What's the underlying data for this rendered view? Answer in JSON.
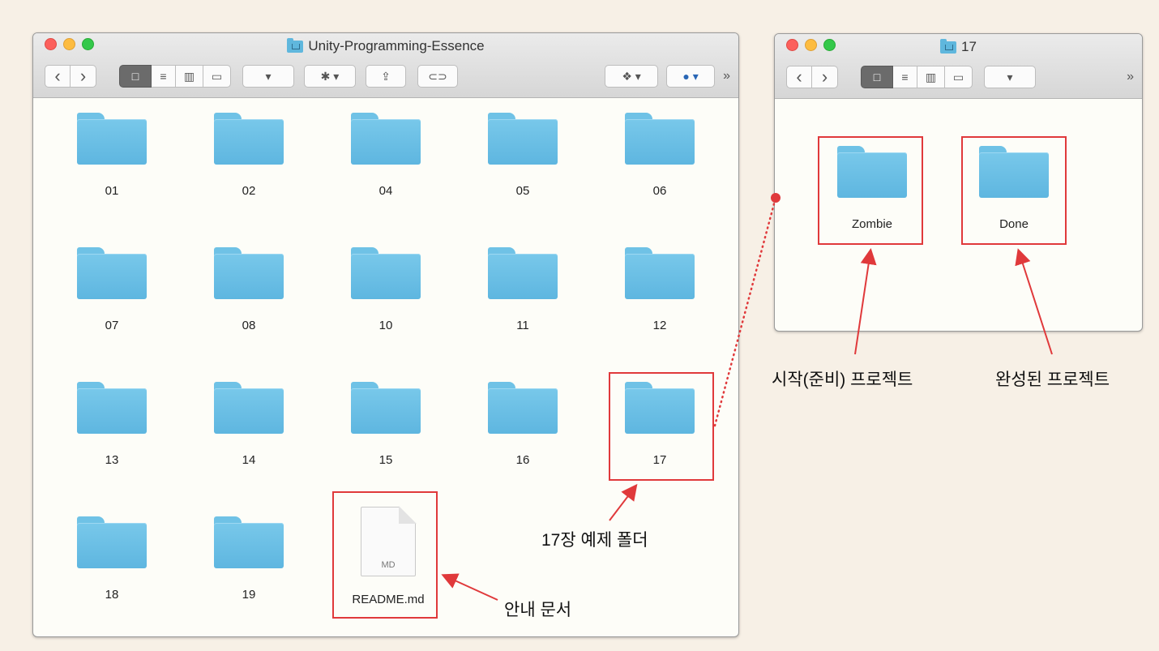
{
  "main_window": {
    "title": "Unity-Programming-Essence",
    "toolbar": {
      "back": "‹",
      "forward": "›",
      "view_icon": "□",
      "view_list": "≡",
      "view_columns": "▥",
      "view_gallery": "▭",
      "arrange": "▾",
      "action": "✱ ▾",
      "share": "⇪",
      "tag": "⊂⊃",
      "dropbox": "❖ ▾",
      "app": "● ▾",
      "more": "»"
    },
    "items": [
      {
        "label": "01"
      },
      {
        "label": "02"
      },
      {
        "label": "04"
      },
      {
        "label": "05"
      },
      {
        "label": "06"
      },
      {
        "label": "07"
      },
      {
        "label": "08"
      },
      {
        "label": "10"
      },
      {
        "label": "11"
      },
      {
        "label": "12"
      },
      {
        "label": "13"
      },
      {
        "label": "14"
      },
      {
        "label": "15"
      },
      {
        "label": "16"
      },
      {
        "label": "17"
      },
      {
        "label": "18"
      },
      {
        "label": "19"
      }
    ],
    "readme": {
      "label": "README.md",
      "badge": "MD"
    }
  },
  "folder17_window": {
    "title": "17",
    "toolbar": {
      "back": "‹",
      "forward": "›",
      "arrange": "▾",
      "more": "»"
    },
    "items": [
      {
        "label": "Zombie"
      },
      {
        "label": "Done"
      }
    ]
  },
  "annotations": {
    "folder17": "17장 예제 폴더",
    "readme": "안내 문서",
    "start": "시작(준비) 프로젝트",
    "done": "완성된 프로젝트"
  },
  "colors": {
    "highlight": "#e0393b",
    "folder": "#66bde4"
  }
}
